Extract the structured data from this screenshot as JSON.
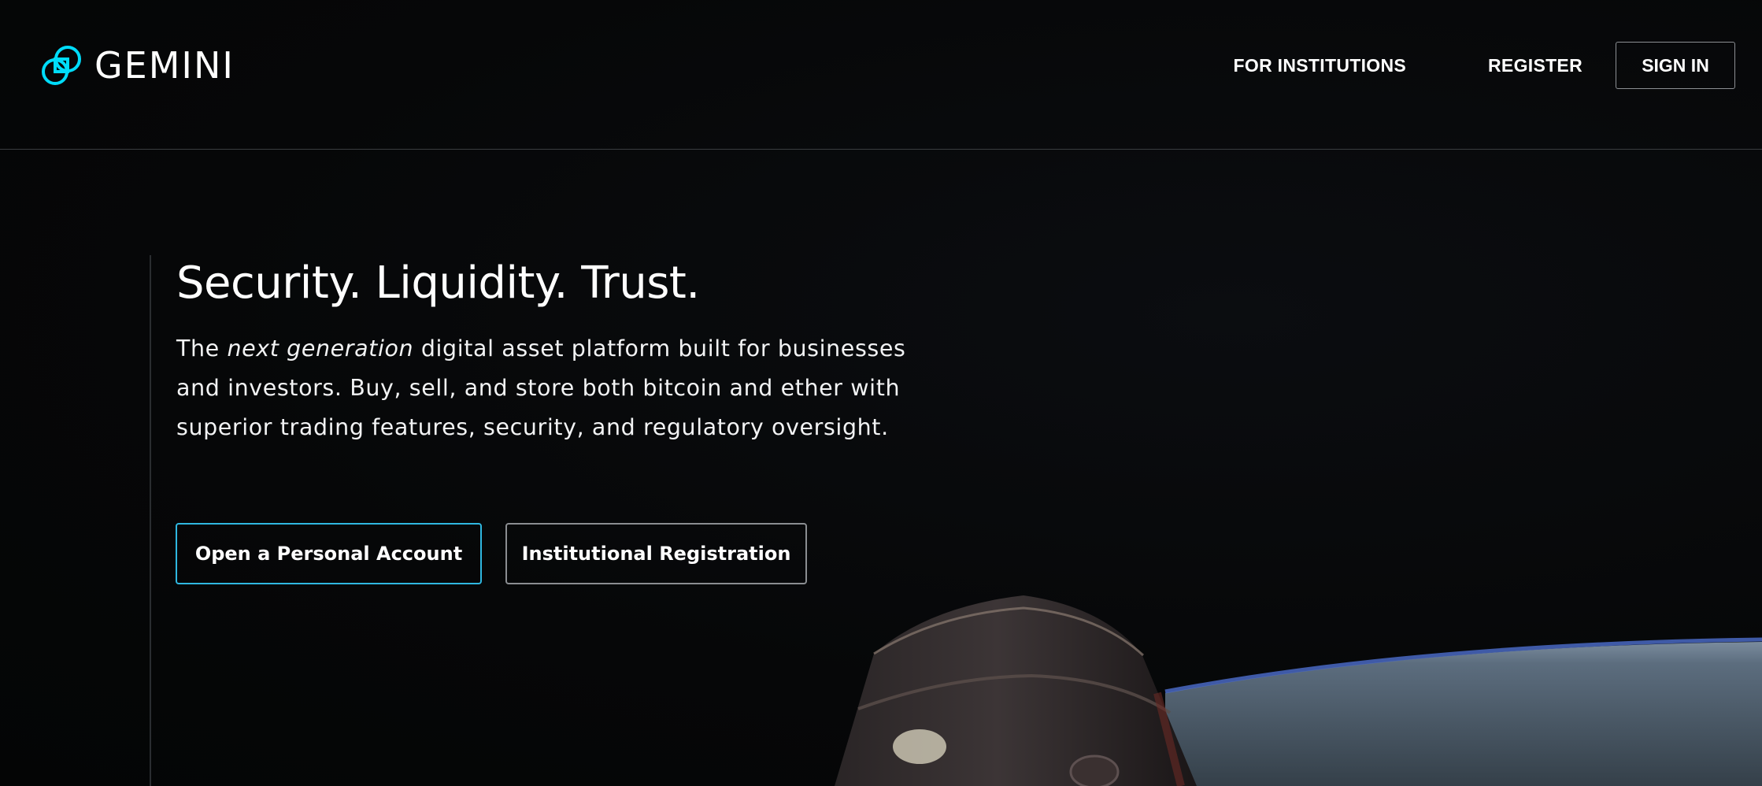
{
  "header": {
    "brand": "GEMINI",
    "nav": {
      "institutions_label": "FOR INSTITUTIONS",
      "register_label": "REGISTER",
      "signin_label": "SIGN IN"
    }
  },
  "hero": {
    "headline": "Security. Liquidity. Trust.",
    "body_prefix": "The ",
    "body_emphasis": "next generation",
    "body_suffix": " digital asset platform built for businesses and investors. Buy, sell, and store both bitcoin and ether with superior trading features, security, and regulatory oversight.",
    "cta_personal": "Open a Personal Account",
    "cta_institutional": "Institutional Registration"
  },
  "colors": {
    "accent": "#2fb7e0",
    "background": "#050607",
    "text": "#ffffff"
  },
  "icons": {
    "logo": "gemini-logo-icon"
  }
}
